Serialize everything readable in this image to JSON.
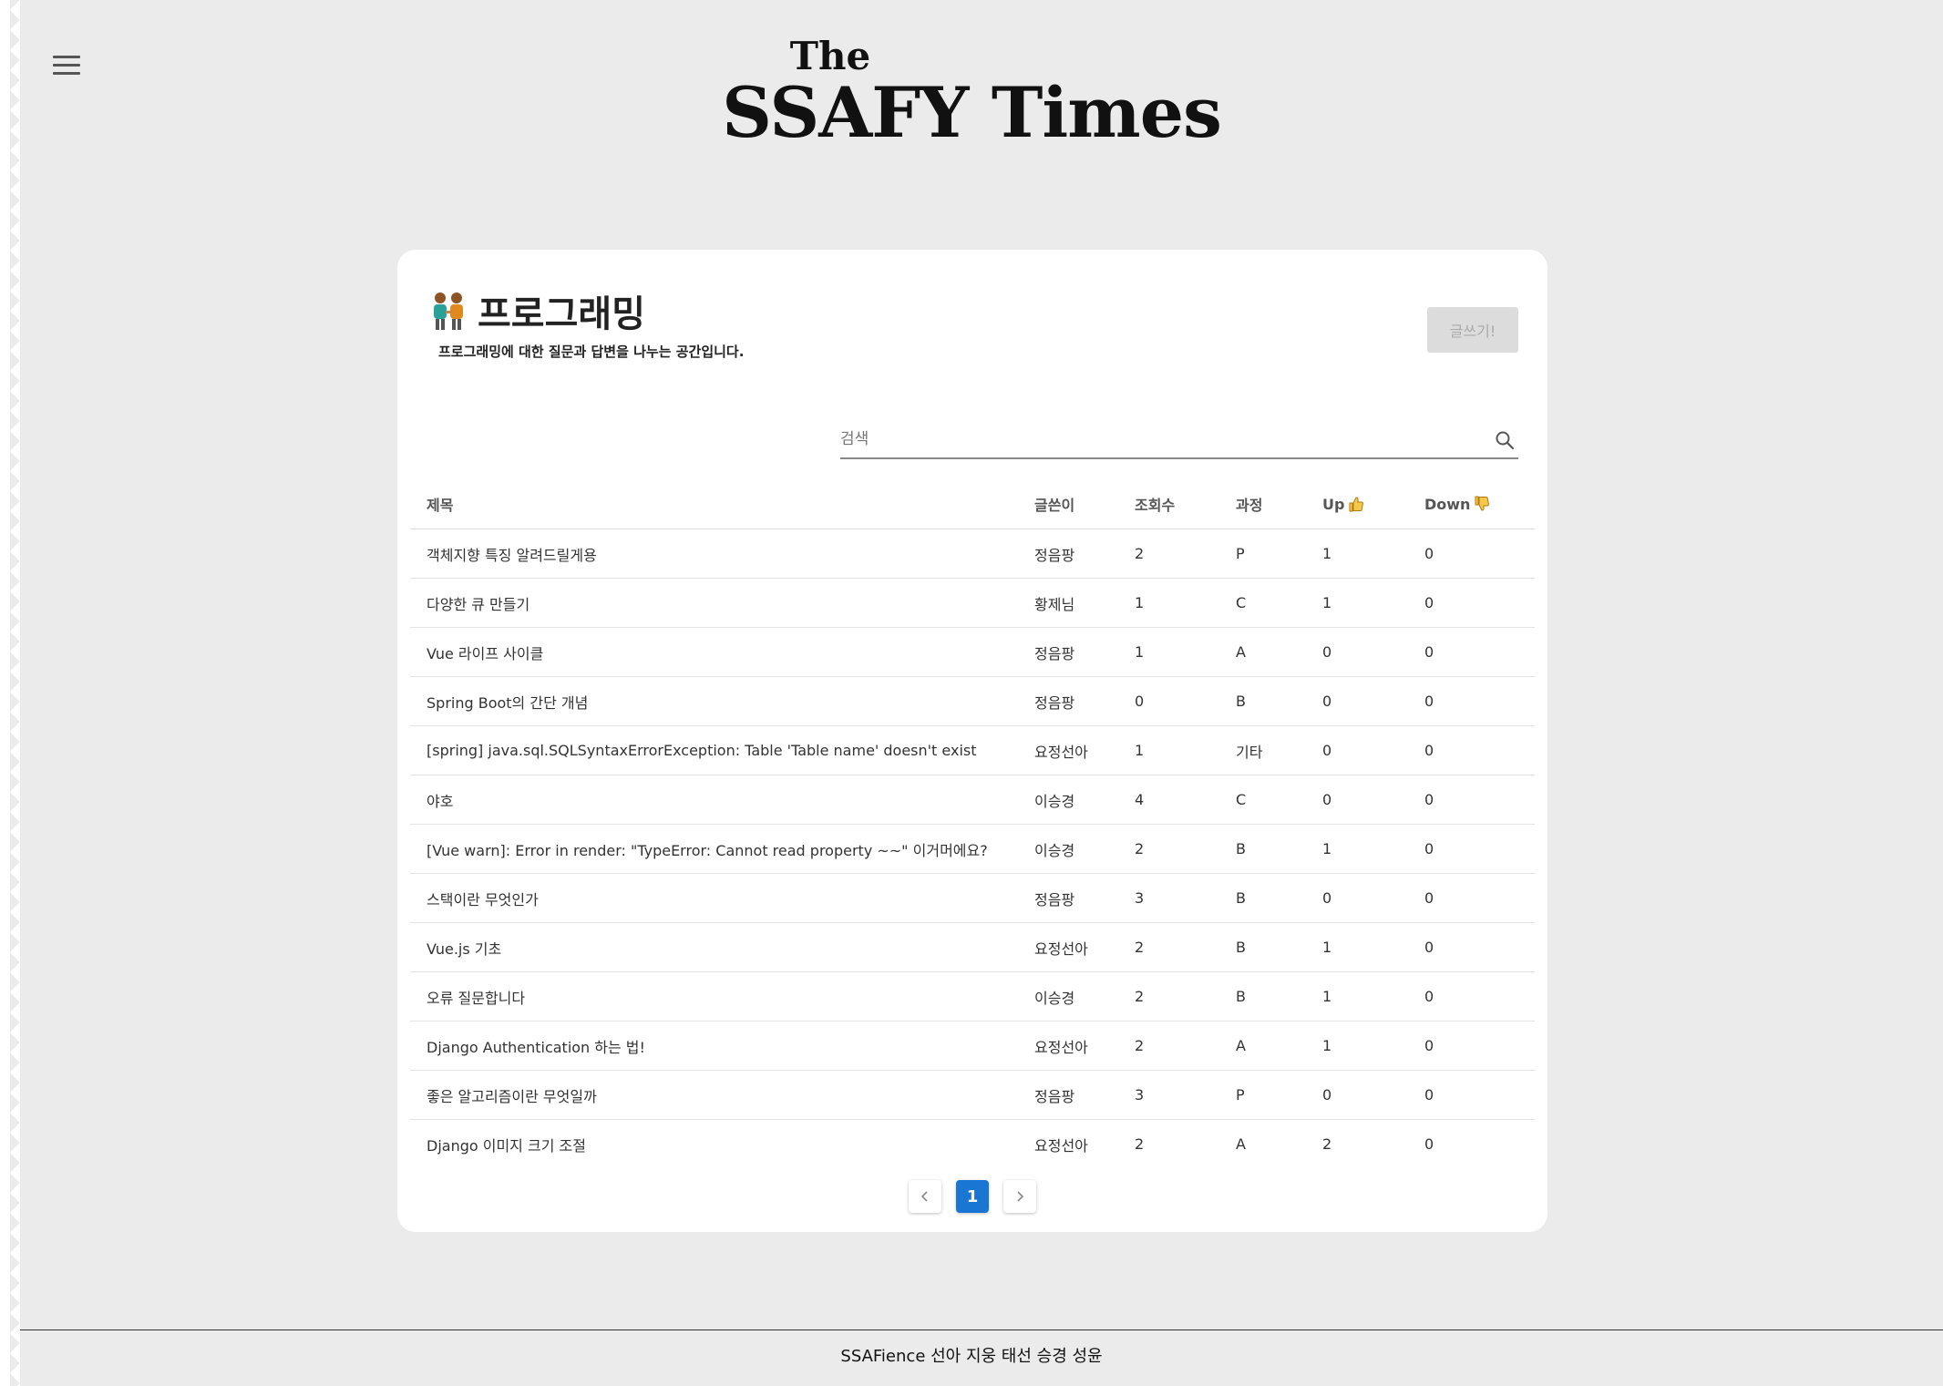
{
  "header": {
    "logo_the": "The",
    "logo_name": "SSAFY Times"
  },
  "board": {
    "title": "프로그래밍",
    "description": "프로그래밍에 대한 질문과 답변을 나누는 공간입니다.",
    "write_label": "글쓰기!"
  },
  "search": {
    "placeholder": "검색"
  },
  "table": {
    "headers": {
      "title": "제목",
      "author": "글쓴이",
      "views": "조회수",
      "course": "과정",
      "up": "Up",
      "down": "Down"
    },
    "rows": [
      {
        "title": "객체지향 특징 알려드릴게용",
        "author": "정음팡",
        "views": "2",
        "course": "P",
        "up": "1",
        "down": "0"
      },
      {
        "title": "다양한 큐 만들기",
        "author": "황제님",
        "views": "1",
        "course": "C",
        "up": "1",
        "down": "0"
      },
      {
        "title": "Vue 라이프 사이클",
        "author": "정음팡",
        "views": "1",
        "course": "A",
        "up": "0",
        "down": "0"
      },
      {
        "title": "Spring Boot의 간단 개념",
        "author": "정음팡",
        "views": "0",
        "course": "B",
        "up": "0",
        "down": "0"
      },
      {
        "title": "[spring] java.sql.SQLSyntaxErrorException: Table 'Table name' doesn't exist",
        "author": "요정선아",
        "views": "1",
        "course": "기타",
        "up": "0",
        "down": "0"
      },
      {
        "title": "야호",
        "author": "이승경",
        "views": "4",
        "course": "C",
        "up": "0",
        "down": "0"
      },
      {
        "title": "[Vue warn]: Error in render: \"TypeError: Cannot read property ~~\" 이거머에요?",
        "author": "이승경",
        "views": "2",
        "course": "B",
        "up": "1",
        "down": "0"
      },
      {
        "title": "스택이란 무엇인가",
        "author": "정음팡",
        "views": "3",
        "course": "B",
        "up": "0",
        "down": "0"
      },
      {
        "title": "Vue.js 기초",
        "author": "요정선아",
        "views": "2",
        "course": "B",
        "up": "1",
        "down": "0"
      },
      {
        "title": "오류 질문합니다",
        "author": "이승경",
        "views": "2",
        "course": "B",
        "up": "1",
        "down": "0"
      },
      {
        "title": "Django Authentication 하는 법!",
        "author": "요정선아",
        "views": "2",
        "course": "A",
        "up": "1",
        "down": "0"
      },
      {
        "title": "좋은 알고리즘이란 무엇일까",
        "author": "정음팡",
        "views": "3",
        "course": "P",
        "up": "0",
        "down": "0"
      },
      {
        "title": "Django 이미지 크기 조절",
        "author": "요정선아",
        "views": "2",
        "course": "A",
        "up": "2",
        "down": "0"
      }
    ]
  },
  "pagination": {
    "current": "1"
  },
  "footer": {
    "text": "SSAFience 선아  지웅  태선  승경  성윤"
  },
  "colors": {
    "accent": "#1976d2",
    "background": "#ebebeb"
  }
}
